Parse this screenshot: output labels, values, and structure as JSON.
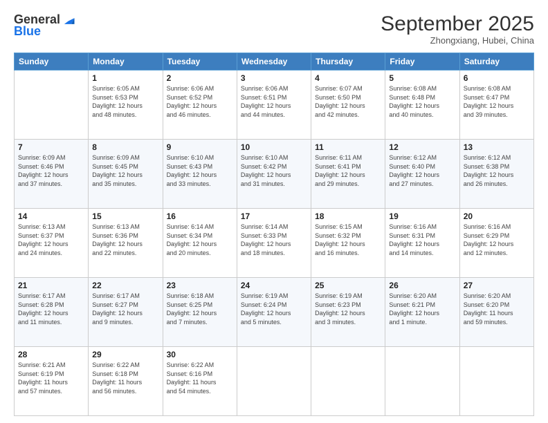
{
  "logo": {
    "line1": "General",
    "line2": "Blue"
  },
  "header": {
    "title": "September 2025",
    "subtitle": "Zhongxiang, Hubei, China"
  },
  "columns": [
    "Sunday",
    "Monday",
    "Tuesday",
    "Wednesday",
    "Thursday",
    "Friday",
    "Saturday"
  ],
  "weeks": [
    [
      {
        "day": "",
        "info": ""
      },
      {
        "day": "1",
        "info": "Sunrise: 6:05 AM\nSunset: 6:53 PM\nDaylight: 12 hours\nand 48 minutes."
      },
      {
        "day": "2",
        "info": "Sunrise: 6:06 AM\nSunset: 6:52 PM\nDaylight: 12 hours\nand 46 minutes."
      },
      {
        "day": "3",
        "info": "Sunrise: 6:06 AM\nSunset: 6:51 PM\nDaylight: 12 hours\nand 44 minutes."
      },
      {
        "day": "4",
        "info": "Sunrise: 6:07 AM\nSunset: 6:50 PM\nDaylight: 12 hours\nand 42 minutes."
      },
      {
        "day": "5",
        "info": "Sunrise: 6:08 AM\nSunset: 6:48 PM\nDaylight: 12 hours\nand 40 minutes."
      },
      {
        "day": "6",
        "info": "Sunrise: 6:08 AM\nSunset: 6:47 PM\nDaylight: 12 hours\nand 39 minutes."
      }
    ],
    [
      {
        "day": "7",
        "info": "Sunrise: 6:09 AM\nSunset: 6:46 PM\nDaylight: 12 hours\nand 37 minutes."
      },
      {
        "day": "8",
        "info": "Sunrise: 6:09 AM\nSunset: 6:45 PM\nDaylight: 12 hours\nand 35 minutes."
      },
      {
        "day": "9",
        "info": "Sunrise: 6:10 AM\nSunset: 6:43 PM\nDaylight: 12 hours\nand 33 minutes."
      },
      {
        "day": "10",
        "info": "Sunrise: 6:10 AM\nSunset: 6:42 PM\nDaylight: 12 hours\nand 31 minutes."
      },
      {
        "day": "11",
        "info": "Sunrise: 6:11 AM\nSunset: 6:41 PM\nDaylight: 12 hours\nand 29 minutes."
      },
      {
        "day": "12",
        "info": "Sunrise: 6:12 AM\nSunset: 6:40 PM\nDaylight: 12 hours\nand 27 minutes."
      },
      {
        "day": "13",
        "info": "Sunrise: 6:12 AM\nSunset: 6:38 PM\nDaylight: 12 hours\nand 26 minutes."
      }
    ],
    [
      {
        "day": "14",
        "info": "Sunrise: 6:13 AM\nSunset: 6:37 PM\nDaylight: 12 hours\nand 24 minutes."
      },
      {
        "day": "15",
        "info": "Sunrise: 6:13 AM\nSunset: 6:36 PM\nDaylight: 12 hours\nand 22 minutes."
      },
      {
        "day": "16",
        "info": "Sunrise: 6:14 AM\nSunset: 6:34 PM\nDaylight: 12 hours\nand 20 minutes."
      },
      {
        "day": "17",
        "info": "Sunrise: 6:14 AM\nSunset: 6:33 PM\nDaylight: 12 hours\nand 18 minutes."
      },
      {
        "day": "18",
        "info": "Sunrise: 6:15 AM\nSunset: 6:32 PM\nDaylight: 12 hours\nand 16 minutes."
      },
      {
        "day": "19",
        "info": "Sunrise: 6:16 AM\nSunset: 6:31 PM\nDaylight: 12 hours\nand 14 minutes."
      },
      {
        "day": "20",
        "info": "Sunrise: 6:16 AM\nSunset: 6:29 PM\nDaylight: 12 hours\nand 12 minutes."
      }
    ],
    [
      {
        "day": "21",
        "info": "Sunrise: 6:17 AM\nSunset: 6:28 PM\nDaylight: 12 hours\nand 11 minutes."
      },
      {
        "day": "22",
        "info": "Sunrise: 6:17 AM\nSunset: 6:27 PM\nDaylight: 12 hours\nand 9 minutes."
      },
      {
        "day": "23",
        "info": "Sunrise: 6:18 AM\nSunset: 6:25 PM\nDaylight: 12 hours\nand 7 minutes."
      },
      {
        "day": "24",
        "info": "Sunrise: 6:19 AM\nSunset: 6:24 PM\nDaylight: 12 hours\nand 5 minutes."
      },
      {
        "day": "25",
        "info": "Sunrise: 6:19 AM\nSunset: 6:23 PM\nDaylight: 12 hours\nand 3 minutes."
      },
      {
        "day": "26",
        "info": "Sunrise: 6:20 AM\nSunset: 6:21 PM\nDaylight: 12 hours\nand 1 minute."
      },
      {
        "day": "27",
        "info": "Sunrise: 6:20 AM\nSunset: 6:20 PM\nDaylight: 11 hours\nand 59 minutes."
      }
    ],
    [
      {
        "day": "28",
        "info": "Sunrise: 6:21 AM\nSunset: 6:19 PM\nDaylight: 11 hours\nand 57 minutes."
      },
      {
        "day": "29",
        "info": "Sunrise: 6:22 AM\nSunset: 6:18 PM\nDaylight: 11 hours\nand 56 minutes."
      },
      {
        "day": "30",
        "info": "Sunrise: 6:22 AM\nSunset: 6:16 PM\nDaylight: 11 hours\nand 54 minutes."
      },
      {
        "day": "",
        "info": ""
      },
      {
        "day": "",
        "info": ""
      },
      {
        "day": "",
        "info": ""
      },
      {
        "day": "",
        "info": ""
      }
    ]
  ]
}
